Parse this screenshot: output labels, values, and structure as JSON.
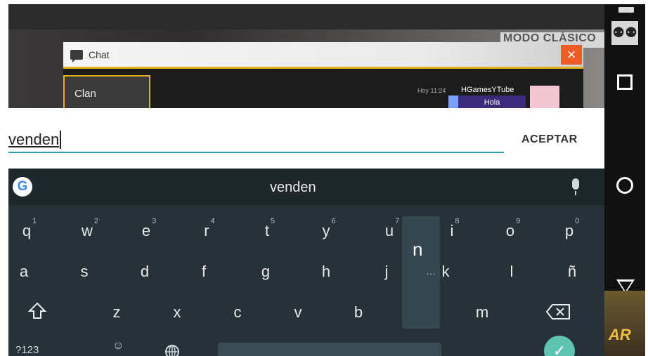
{
  "game": {
    "mode_label": "MODO CLÁSICO",
    "chat_title": "Chat",
    "close_label": "×",
    "clan_tab": "Clan",
    "message": {
      "time": "Hoy 11:24",
      "user": "HGamesYTube",
      "text": "Hola"
    },
    "corner_text": "AR"
  },
  "input": {
    "value": "venden",
    "accept_label": "ACEPTAR"
  },
  "keyboard": {
    "suggestion": "venden",
    "row1": [
      {
        "k": "q",
        "n": "1"
      },
      {
        "k": "w",
        "n": "2"
      },
      {
        "k": "e",
        "n": "3"
      },
      {
        "k": "r",
        "n": "4"
      },
      {
        "k": "t",
        "n": "5"
      },
      {
        "k": "y",
        "n": "6"
      },
      {
        "k": "u",
        "n": "7"
      },
      {
        "k": "i",
        "n": "8"
      },
      {
        "k": "o",
        "n": "9"
      },
      {
        "k": "p",
        "n": "0"
      }
    ],
    "row2": [
      "a",
      "s",
      "d",
      "f",
      "g",
      "h",
      "j",
      "k",
      "l",
      "ñ"
    ],
    "row3": [
      "z",
      "x",
      "c",
      "v",
      "b",
      "m"
    ],
    "pressed_key": "n",
    "pressed_hint": "…",
    "symbols_label": "?123",
    "emoji_label": "☺",
    "enter_label": "✓"
  },
  "colors": {
    "accent": "#2e9fa8",
    "close": "#f05a24",
    "keyboard_bg": "#263238",
    "enter": "#5ec4b2"
  }
}
